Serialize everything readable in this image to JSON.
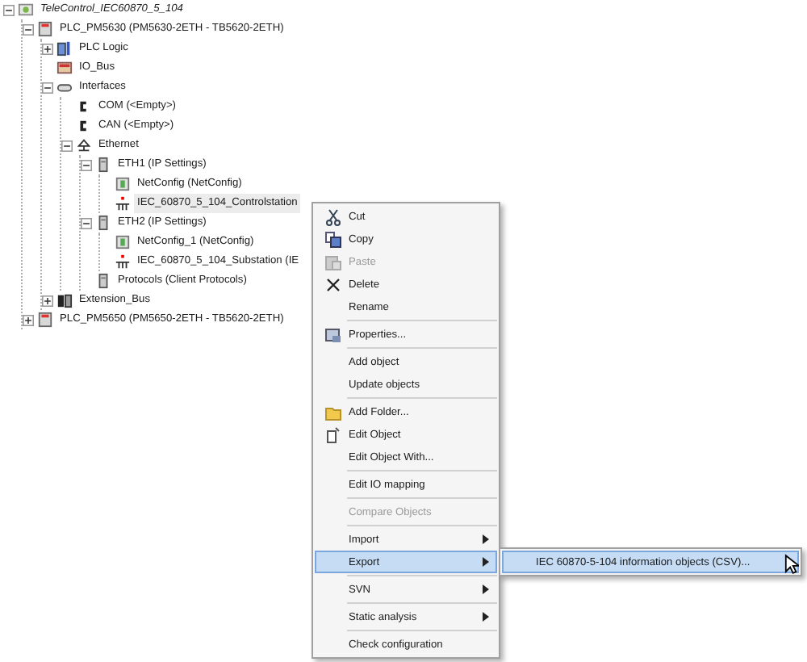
{
  "tree": [
    {
      "label": "TeleControl_IEC60870_5_104",
      "kind": "project",
      "expanded": true,
      "selected": false,
      "children": [
        {
          "label": "PLC_PM5630 (PM5630-2ETH - TB5620-2ETH)",
          "kind": "device",
          "expanded": true,
          "selected": false,
          "children": [
            {
              "label": "PLC Logic",
              "kind": "logic",
              "expanded": false,
              "selected": false
            },
            {
              "label": "IO_Bus",
              "kind": "bus",
              "selected": false
            },
            {
              "label": "Interfaces",
              "kind": "interfaces",
              "expanded": true,
              "selected": false,
              "children": [
                {
                  "label": "COM (<Empty>)",
                  "kind": "port",
                  "selected": false
                },
                {
                  "label": "CAN (<Empty>)",
                  "kind": "port",
                  "selected": false
                },
                {
                  "label": "Ethernet",
                  "kind": "ethernet",
                  "expanded": true,
                  "selected": false,
                  "children": [
                    {
                      "label": "ETH1 (IP Settings)",
                      "kind": "eth",
                      "expanded": true,
                      "selected": false,
                      "children": [
                        {
                          "label": "NetConfig (NetConfig)",
                          "kind": "netconfig",
                          "selected": false
                        },
                        {
                          "label": "IEC_60870_5_104_Controlstation",
                          "kind": "station",
                          "selected": true
                        }
                      ]
                    },
                    {
                      "label": "ETH2 (IP Settings)",
                      "kind": "eth",
                      "expanded": true,
                      "selected": false,
                      "children": [
                        {
                          "label": "NetConfig_1 (NetConfig)",
                          "kind": "netconfig",
                          "selected": false
                        },
                        {
                          "label": "IEC_60870_5_104_Substation (IE",
                          "kind": "station",
                          "selected": false
                        }
                      ]
                    },
                    {
                      "label": "Protocols (Client Protocols)",
                      "kind": "eth",
                      "selected": false
                    }
                  ]
                }
              ]
            },
            {
              "label": "Extension_Bus",
              "kind": "extension",
              "expanded": false,
              "selected": false
            }
          ]
        },
        {
          "label": "PLC_PM5650 (PM5650-2ETH - TB5620-2ETH)",
          "kind": "device",
          "expanded": false,
          "selected": false
        }
      ]
    }
  ],
  "context_menu": [
    {
      "kind": "cut",
      "label": "Cut",
      "disabled": false,
      "submenu": false,
      "selected": false
    },
    {
      "kind": "copy",
      "label": "Copy",
      "disabled": false,
      "submenu": false,
      "selected": false
    },
    {
      "kind": "paste",
      "label": "Paste",
      "disabled": true,
      "submenu": false,
      "selected": false
    },
    {
      "kind": "delete",
      "label": "Delete",
      "disabled": false,
      "submenu": false,
      "selected": false
    },
    {
      "kind": "plain",
      "label": "Rename",
      "disabled": false,
      "submenu": false,
      "selected": false
    },
    {
      "kind": "separator"
    },
    {
      "kind": "properties",
      "label": "Properties...",
      "disabled": false,
      "submenu": false,
      "selected": false
    },
    {
      "kind": "separator"
    },
    {
      "kind": "plain",
      "label": "Add object",
      "disabled": false,
      "submenu": false,
      "selected": false
    },
    {
      "kind": "plain",
      "label": "Update objects",
      "disabled": false,
      "submenu": false,
      "selected": false
    },
    {
      "kind": "separator"
    },
    {
      "kind": "folder",
      "label": "Add Folder...",
      "disabled": false,
      "submenu": false,
      "selected": false
    },
    {
      "kind": "edit",
      "label": "Edit Object",
      "disabled": false,
      "submenu": false,
      "selected": false
    },
    {
      "kind": "plain",
      "label": "Edit Object With...",
      "disabled": false,
      "submenu": false,
      "selected": false
    },
    {
      "kind": "separator"
    },
    {
      "kind": "plain",
      "label": "Edit IO mapping",
      "disabled": false,
      "submenu": false,
      "selected": false
    },
    {
      "kind": "separator"
    },
    {
      "kind": "plain",
      "label": "Compare Objects",
      "disabled": true,
      "submenu": false,
      "selected": false
    },
    {
      "kind": "separator"
    },
    {
      "kind": "plain",
      "label": "Import",
      "disabled": false,
      "submenu": true,
      "selected": false
    },
    {
      "kind": "plain",
      "label": "Export",
      "disabled": false,
      "submenu": true,
      "selected": true,
      "children": [
        {
          "label": "IEC 60870-5-104 information objects (CSV)...",
          "selected": true
        }
      ]
    },
    {
      "kind": "separator"
    },
    {
      "kind": "plain",
      "label": "SVN",
      "disabled": false,
      "submenu": true,
      "selected": false
    },
    {
      "kind": "separator"
    },
    {
      "kind": "plain",
      "label": "Static analysis",
      "disabled": false,
      "submenu": true,
      "selected": false
    },
    {
      "kind": "separator"
    },
    {
      "kind": "plain",
      "label": "Check configuration",
      "disabled": false,
      "submenu": false,
      "selected": false
    }
  ]
}
